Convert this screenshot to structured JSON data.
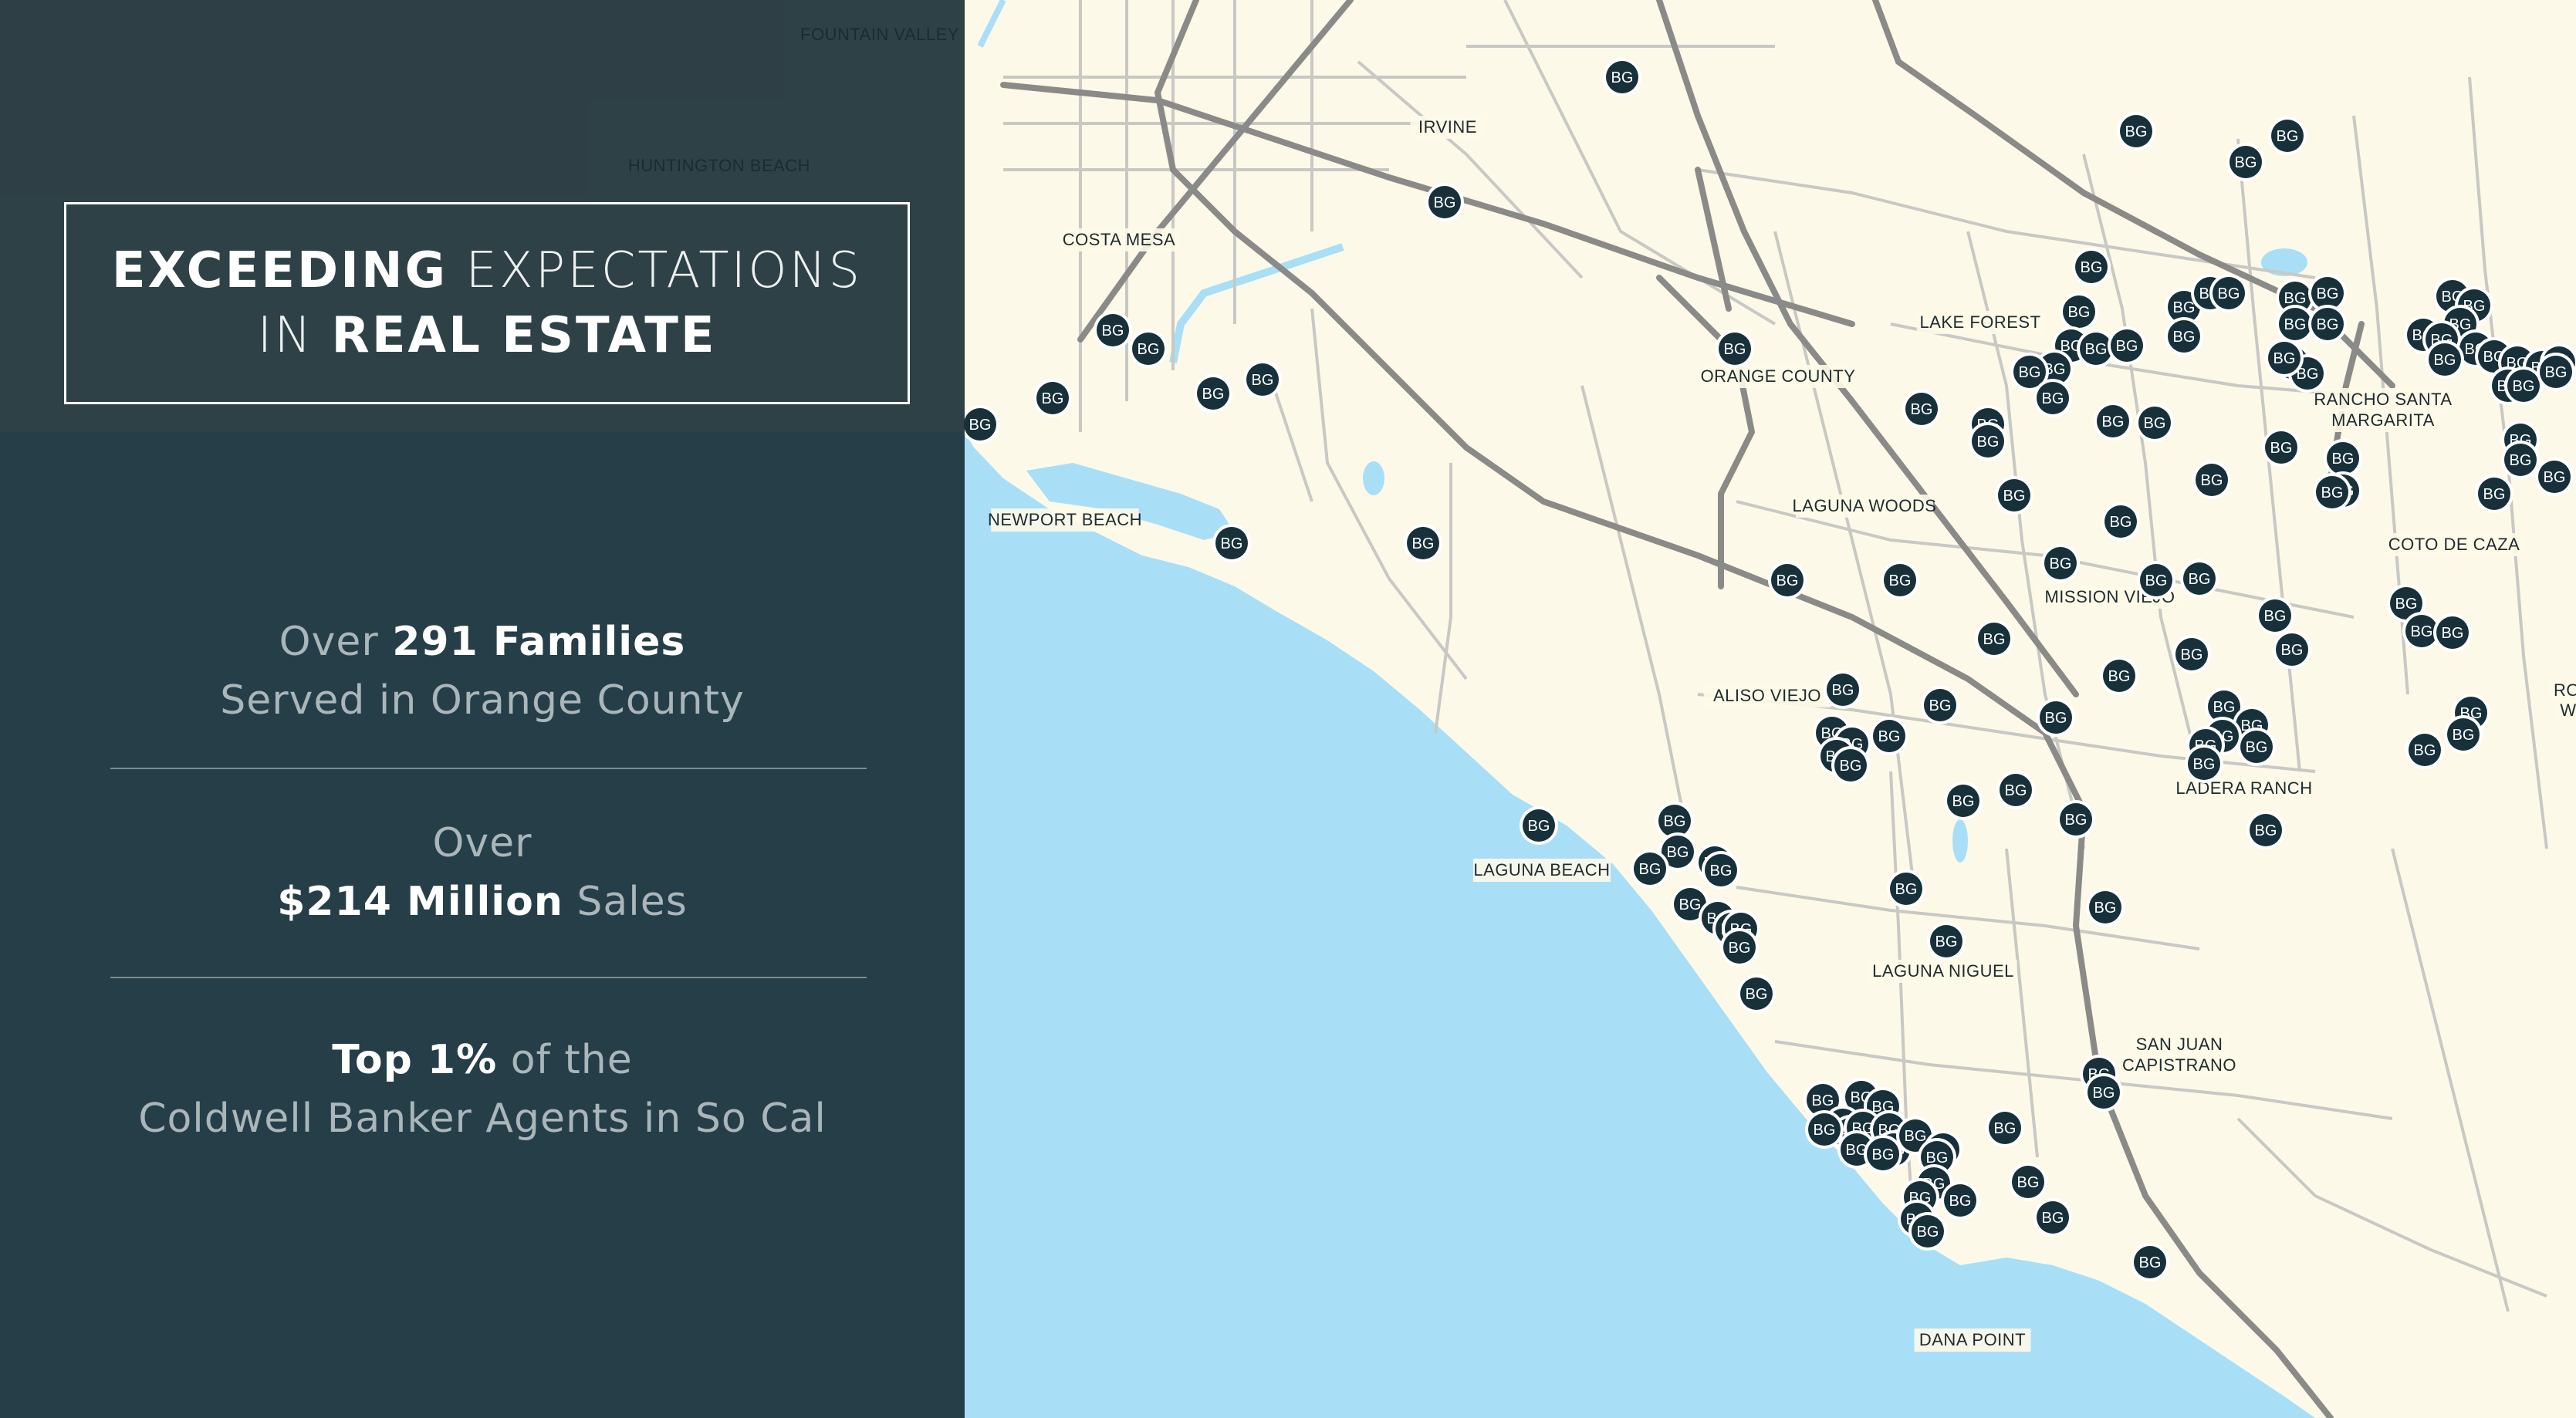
{
  "panel": {
    "headline_line1_a": "EXCEEDING",
    "headline_line1_b": "EXPECTATIONS",
    "headline_line2_a": "IN",
    "headline_line2_b": "REAL ESTATE",
    "stats": [
      {
        "pre": "Over",
        "highlight": "291 Families",
        "post": "",
        "line2": "Served in Orange County"
      },
      {
        "pre": "Over",
        "highlight": "$214 Million",
        "post": "Sales"
      },
      {
        "pre": "",
        "highlight": "Top 1%",
        "post": "of the",
        "line2": "Coldwell Banker Agents in So Cal"
      }
    ]
  },
  "map": {
    "marker_label": "BG",
    "places": [
      {
        "name": "FOUNTAIN VALLEY"
      },
      {
        "name": "HUNTINGTON BEACH"
      },
      {
        "name": "IRVINE"
      },
      {
        "name": "COSTA MESA"
      },
      {
        "name": "LAKE FOREST"
      },
      {
        "name": "ORANGE COUNTY"
      },
      {
        "name": "RANCHO SANTA"
      },
      {
        "name": "MARGARITA"
      },
      {
        "name": "NEWPORT BEACH"
      },
      {
        "name": "LAGUNA WOODS"
      },
      {
        "name": "COTO DE CAZA"
      },
      {
        "name": "MISSION VIEJO"
      },
      {
        "name": "ALISO VIEJO"
      },
      {
        "name": "LADERA RANCH"
      },
      {
        "name": "LAGUNA BEACH"
      },
      {
        "name": "LAGUNA NIGUEL"
      },
      {
        "name": "SAN JUAN"
      },
      {
        "name": "CAPISTRANO"
      },
      {
        "name": "DANA POINT"
      },
      {
        "name": "RO"
      },
      {
        "name": "W"
      }
    ],
    "colors": {
      "land": "#fdf9e8",
      "water": "#a8dff7",
      "road": "#c8c8c4",
      "highway": "#8a8a88",
      "marker": "#17303a",
      "panel": "#172c34"
    }
  }
}
